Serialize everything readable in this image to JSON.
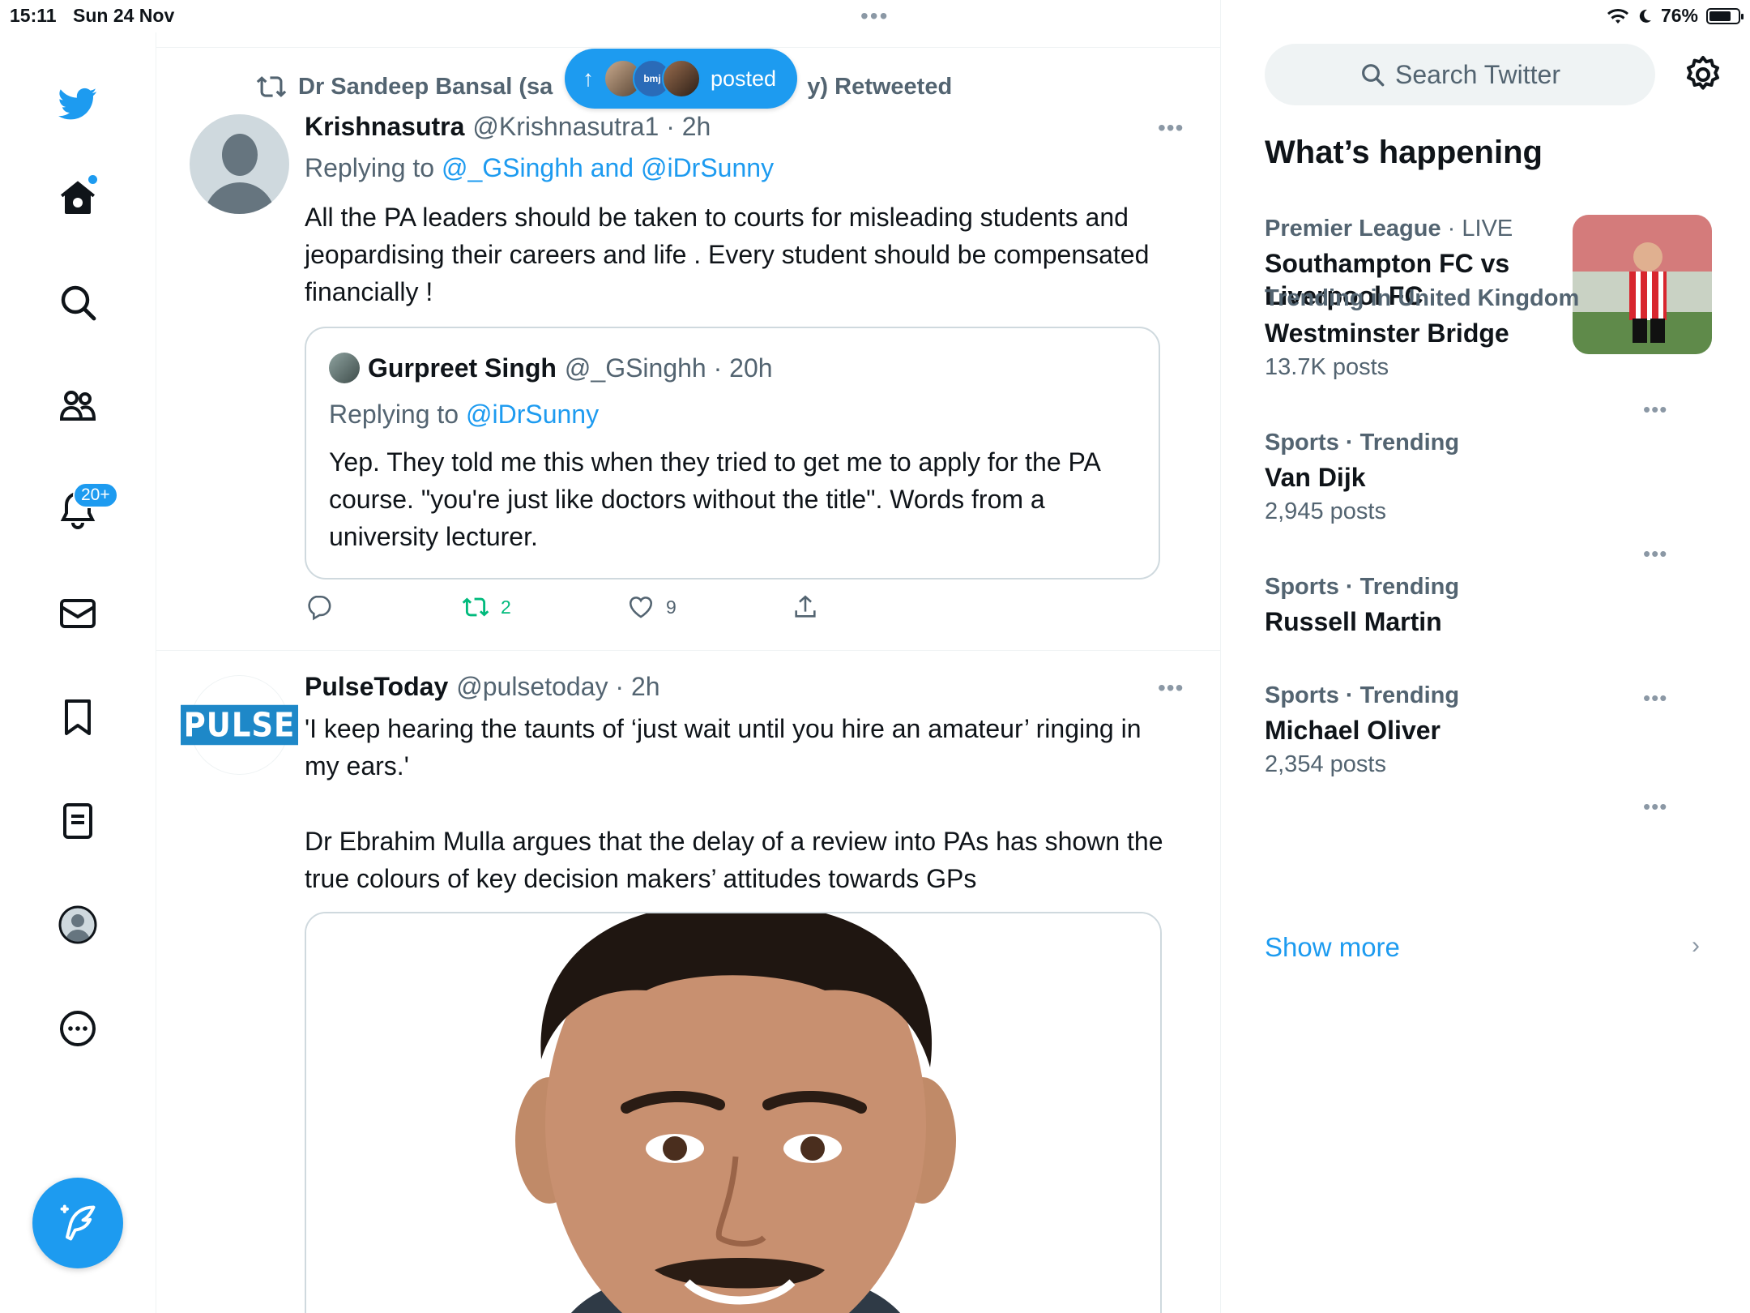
{
  "status_bar": {
    "time": "15:11",
    "date": "Sun 24 Nov",
    "battery": "76%",
    "battery_level": 0.76
  },
  "nav": {
    "notifications_badge": "20+",
    "items": [
      "home",
      "explore",
      "communities",
      "notifications",
      "messages",
      "bookmarks",
      "lists",
      "profile",
      "more"
    ]
  },
  "feed": {
    "new_posts": {
      "label": "posted",
      "arrow": "↑",
      "avatar_text": "bmj"
    },
    "tweet1": {
      "retweeted_by": "Dr Sandeep Bansal (sa",
      "retweeted_suffix": "y) Retweeted",
      "name": "Krishnasutra",
      "handle": "@Krishnasutra1 · 2h",
      "replying_prefix": "Replying to ",
      "replying_to": "@_GSinghh and @iDrSunny",
      "text": "All the PA leaders should be taken to courts for misleading students and jeopardising their careers and life . Every student should be compensated financially !",
      "quote": {
        "name": "Gurpreet Singh",
        "handle": "@_GSinghh · 20h",
        "replying_prefix": "Replying to ",
        "replying_to": "@iDrSunny",
        "text": "Yep. They told me this when they tried to get me to apply for the PA course. \"you're just like doctors without the title\". Words from a university lecturer."
      },
      "retweets": "2",
      "likes": "9"
    },
    "tweet2": {
      "logo_text": "PULSE",
      "name": "PulseToday",
      "handle": "@pulsetoday · 2h",
      "text1": "'I keep hearing the taunts of ‘just wait until you hire an amateur’ ringing in my ears.'",
      "text2": "Dr Ebrahim Mulla argues that the delay of a review into PAs has shown the true colours of key decision makers’ attitudes towards GPs"
    }
  },
  "sidebar": {
    "search_placeholder": "Search Twitter",
    "title": "What’s happening",
    "trends": [
      {
        "category_bold": "Premier League",
        "category_rest": " · LIVE",
        "name": "Southampton FC vs Liverpool FC",
        "count": ""
      },
      {
        "category_bold": "Trending in United Kingdom",
        "category_rest": "",
        "name": "Westminster Bridge",
        "count": "13.7K posts"
      },
      {
        "category_bold": "Sports · Trending",
        "category_rest": "",
        "name": "Van Dijk",
        "count": "2,945 posts"
      },
      {
        "category_bold": "Sports · Trending",
        "category_rest": "",
        "name": "Russell Martin",
        "count": ""
      },
      {
        "category_bold": "Sports · Trending",
        "category_rest": "",
        "name": "Michael Oliver",
        "count": "2,354 posts"
      }
    ],
    "show_more": "Show more"
  },
  "colors": {
    "accent": "#1d9bf0",
    "retweet": "#00ba7c",
    "secondary_text": "#536471"
  }
}
